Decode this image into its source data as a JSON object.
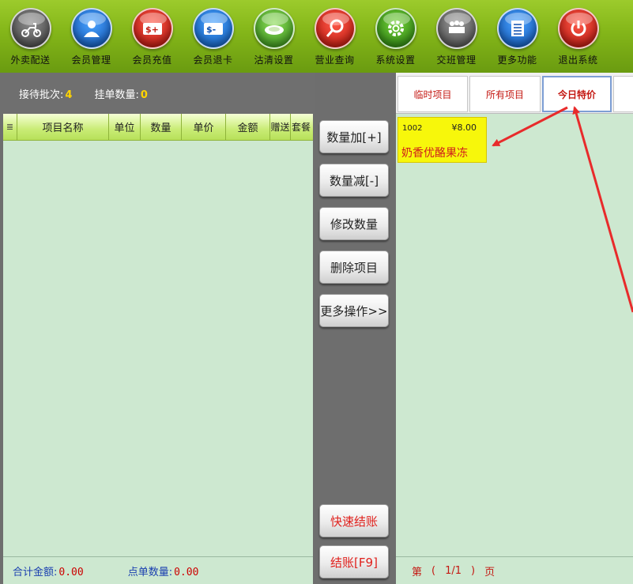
{
  "toolbar": {
    "items": [
      {
        "label": "外卖配送",
        "icon": "scooter-icon",
        "color": "#5a5a5a"
      },
      {
        "label": "会员管理",
        "icon": "user-icon",
        "color": "#1a6fd8"
      },
      {
        "label": "会员充值",
        "icon": "card-plus-icon",
        "color": "#d41f12"
      },
      {
        "label": "会员退卡",
        "icon": "card-minus-icon",
        "color": "#1a6fd8"
      },
      {
        "label": "沽清设置",
        "icon": "plate-icon",
        "color": "#3e9e1e"
      },
      {
        "label": "营业查询",
        "icon": "search-icon",
        "color": "#d41f12"
      },
      {
        "label": "系统设置",
        "icon": "gear-icon",
        "color": "#2e8a12"
      },
      {
        "label": "交班管理",
        "icon": "handover-icon",
        "color": "#5a5a5a"
      },
      {
        "label": "更多功能",
        "icon": "list-icon",
        "color": "#1a6fd8"
      },
      {
        "label": "退出系统",
        "icon": "power-icon",
        "color": "#d41f12"
      }
    ]
  },
  "left_header": {
    "waiting_label": "接待批次:",
    "waiting_value": "4",
    "hold_label": "挂单数量:",
    "hold_value": "0"
  },
  "table": {
    "columns": [
      "项目名称",
      "单位",
      "数量",
      "单价",
      "金额",
      "赠送",
      "套餐"
    ],
    "rows": []
  },
  "left_footer": {
    "total_label": "合计金额:",
    "total_value": "0.00",
    "count_label": "点单数量:",
    "count_value": "0.00"
  },
  "buttons": {
    "qty_add": "数量加[+]",
    "qty_sub": "数量减[-]",
    "qty_edit": "修改数量",
    "delete_item": "删除项目",
    "more_ops": "更多操作>>",
    "quick_checkout": "快速结账",
    "checkout": "结账[F9]"
  },
  "tabs": [
    {
      "label": "临时项目",
      "active": false
    },
    {
      "label": "所有项目",
      "active": false
    },
    {
      "label": "今日特价",
      "active": true
    }
  ],
  "products": [
    {
      "code": "1002",
      "price": "¥8.00",
      "name": "奶香优酪果冻"
    }
  ],
  "pager": {
    "prefix": "第",
    "open": "(",
    "page": "1/1",
    "close": ")",
    "suffix": "页"
  },
  "colors": {
    "toolbar_green": "#86b81a",
    "panel_bg": "#cde8d0",
    "side_gray": "#6e6e6e",
    "accent_red": "#c41812",
    "accent_yellow": "#f7f70b",
    "arrow_red": "#e82b2b"
  }
}
